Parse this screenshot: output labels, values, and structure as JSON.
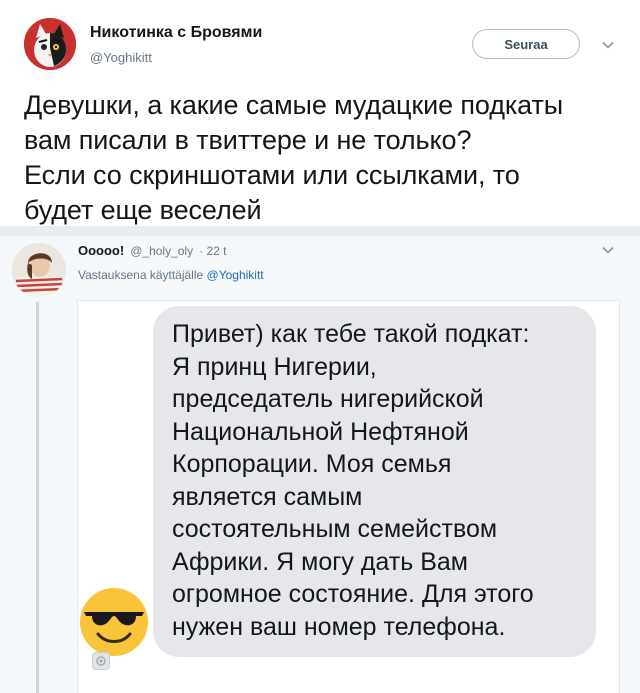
{
  "tweet": {
    "author_name": "Никотинка с Бровями",
    "author_handle": "@Yoghikitt",
    "follow_label": "Seuraa",
    "text": "Девушки, а какие самые мудацкие подкаты\nвам писали в твиттере и не только?\nЕсли со скриншотами или ссылками, то\nбудет еще веселей"
  },
  "reply": {
    "author_name": "Ooooo!",
    "author_handle": "@_holy_oly",
    "time": "· 22 t",
    "replying_prefix": "Vastauksena käyttäjälle",
    "replying_to": "@Yoghikitt",
    "message": "Привет) как тебе такой подкат:\nЯ принц Нигерии,\nпредседатель нигерийской\nНациональной Нефтяной\nКорпорации. Моя семья\nявляется самым\nсостоятельным семейством\nАфрики. Я могу дать Вам\nогромное состояние. Для этого\nнужен ваш номер телефона."
  },
  "colors": {
    "background": "#ffffff",
    "reply_background": "#f5f8fa",
    "link": "#1b6fb5",
    "secondary_text": "#657786",
    "bubble": "#e6e7eb",
    "emoji_yellow": "#f8c43a"
  },
  "icons": [
    "chevron-down-icon",
    "sunglasses-emoji-icon",
    "image-placeholder-icon"
  ]
}
